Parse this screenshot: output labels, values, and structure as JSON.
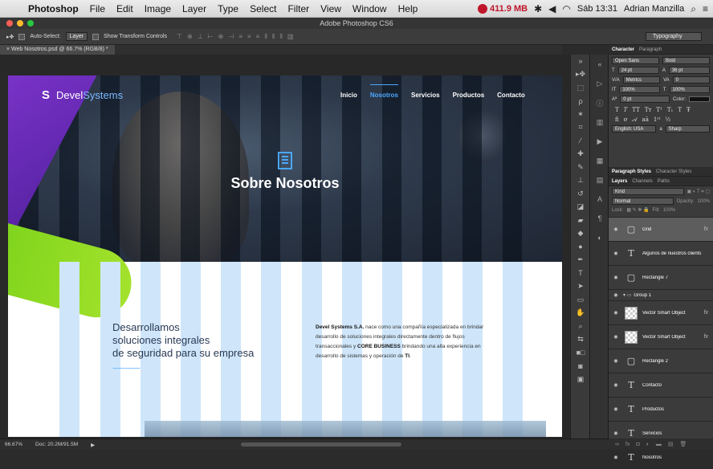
{
  "menubar": {
    "app": "Photoshop",
    "items": [
      "File",
      "Edit",
      "Image",
      "Layer",
      "Type",
      "Select",
      "Filter",
      "View",
      "Window",
      "Help"
    ],
    "memory": "411.9 MB",
    "day_time": "Sáb 13:31",
    "user": "Adrian Manzilla"
  },
  "window": {
    "title": "Adobe Photoshop CS6"
  },
  "options": {
    "auto_select_label": "Auto-Select:",
    "auto_select_value": "Layer",
    "transform_label": "Show Transform Controls",
    "workspace": "Typography"
  },
  "document": {
    "tab": "Web Nosotros.psd @ 66.7% (RGB/8) *",
    "logo_mark": "S",
    "logo_devel": "Devel",
    "logo_systems": "Systems",
    "nav": [
      "Inicio",
      "Nosotros",
      "Servicios",
      "Productos",
      "Contacto"
    ],
    "hero_title": "Sobre Nosotros",
    "heading": [
      "Desarrollamos",
      "soluciones integrales",
      "de seguridad para su empresa"
    ],
    "wave": "~~~~~~~",
    "para": {
      "company": "Devel Systems S.A.",
      "p1": " nace como una compañía especializada en brindar desarrollo de soluciones integrales directamente dentro de flujos transaccionales y ",
      "core": "CORE BUSINESS",
      "p2": " brindando una alta experiencia en desarrollo de sistemas y operación de ",
      "ti": "TI",
      "end": "."
    }
  },
  "character": {
    "tabs": [
      "Character",
      "Paragraph"
    ],
    "font": "Open Sans",
    "style": "Bold",
    "size": "24 pt",
    "leading": "36 pt",
    "kerning": "Metrics",
    "tracking": "0",
    "vscale": "100%",
    "hscale": "100%",
    "baseline": "0 pt",
    "color_label": "Color:",
    "language": "English: USA",
    "aa_label": "a",
    "aa": "Sharp"
  },
  "panels": {
    "styles_tabs": [
      "Paragraph Styles",
      "Character Styles"
    ],
    "layer_tabs": [
      "Layers",
      "Channels",
      "Paths"
    ],
    "kind": "Kind",
    "blend": "Normal",
    "opacity_label": "Opacity:",
    "opacity": "100%",
    "lock_label": "Lock:",
    "fill_label": "Fill:",
    "fill": "100%"
  },
  "layers": [
    {
      "name": "Grid",
      "thumb": "▢",
      "fx": "fx",
      "selected": true
    },
    {
      "name": "Algunos de nuestros clients",
      "thumb": "T",
      "fx": ""
    },
    {
      "name": "Rectangle 7",
      "thumb": "▢",
      "fx": ""
    },
    {
      "name": "Group 1",
      "thumb": "",
      "fx": "",
      "group": true
    },
    {
      "name": "Vector Smart Object",
      "thumb": "obj",
      "fx": "fx"
    },
    {
      "name": "Vector Smart Object",
      "thumb": "obj",
      "fx": "fx"
    },
    {
      "name": "Rectangle 2",
      "thumb": "▢",
      "fx": ""
    },
    {
      "name": "Contacto",
      "thumb": "T",
      "fx": ""
    },
    {
      "name": "Productos",
      "thumb": "T",
      "fx": ""
    },
    {
      "name": "Servicios",
      "thumb": "T",
      "fx": ""
    },
    {
      "name": "Nosotros",
      "thumb": "T",
      "fx": ""
    }
  ],
  "status": {
    "zoom": "66.67%",
    "doc": "Doc: 20.2M/91.5M"
  }
}
